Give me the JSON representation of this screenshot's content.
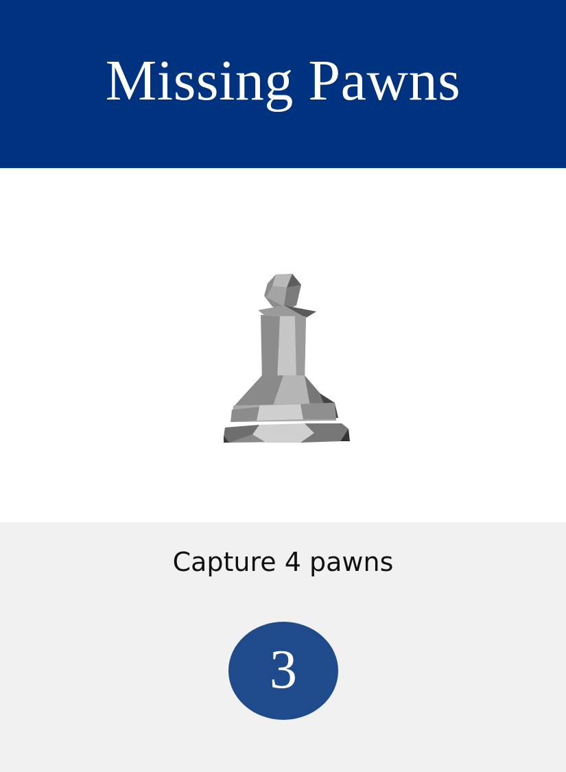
{
  "card": {
    "title": "Missing Pawns",
    "objective": "Capture 4 pawns",
    "value": "3",
    "icon": "chess-pawn-icon",
    "colors": {
      "header": "#00337f",
      "badge": "#1f4a8c",
      "footer": "#f1f1f1"
    }
  }
}
